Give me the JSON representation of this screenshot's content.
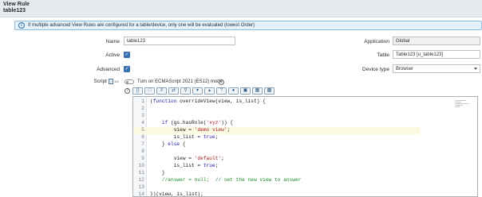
{
  "header": {
    "title": "View Rule",
    "subtitle": "table123"
  },
  "banner": {
    "icon": "info-icon",
    "message": "If multiple advanced View Rules are configured for a table/device, only one will be evaluated (lowest Order)"
  },
  "form": {
    "name": {
      "label": "Name",
      "value": "table123"
    },
    "active": {
      "label": "Active",
      "checked": true
    },
    "advanced": {
      "label": "Advanced",
      "checked": true
    },
    "application": {
      "label": "Application",
      "value": "Global"
    },
    "table": {
      "label": "Table",
      "value": "Table123 [u_table123]"
    },
    "device_type": {
      "label": "Device type",
      "value": "Browser"
    },
    "script": {
      "label": "Script",
      "toggle_label": "Turn on ECMAScript 2021 (ES12) mode"
    }
  },
  "toolbar": [
    "format-icon",
    "comment-icon",
    "tree-icon",
    "replace-icon",
    "search-icon",
    "find-next-icon",
    "find-prev-icon",
    "help-icon",
    "globe-icon",
    "save-icon",
    "fullscreen-icon",
    "export-icon"
  ],
  "editor": {
    "lines": [
      {
        "n": "1",
        "text": "(function overrideView(view, is_list) {"
      },
      {
        "n": "2",
        "text": ""
      },
      {
        "n": "3",
        "text": ""
      },
      {
        "n": "4",
        "text": "    if (gs.hasRole('xyz')) {"
      },
      {
        "n": "5",
        "text": "        view = 'demo view';"
      },
      {
        "n": "6",
        "text": "        is_list = true;"
      },
      {
        "n": "7",
        "text": "    } else {"
      },
      {
        "n": "8",
        "text": ""
      },
      {
        "n": "9",
        "text": "        view = 'default';"
      },
      {
        "n": "10",
        "text": "        is_list = true;"
      },
      {
        "n": "11",
        "text": "    }"
      },
      {
        "n": "12",
        "text": "    //answer = null;  // set the new view to answer"
      },
      {
        "n": "13",
        "text": ""
      },
      {
        "n": "14",
        "text": "})(view, is_list);"
      }
    ]
  },
  "colors": {
    "accent": "#3a6fb0",
    "banner_bg": "#e6f2fb",
    "banner_border": "#8dbce0"
  }
}
